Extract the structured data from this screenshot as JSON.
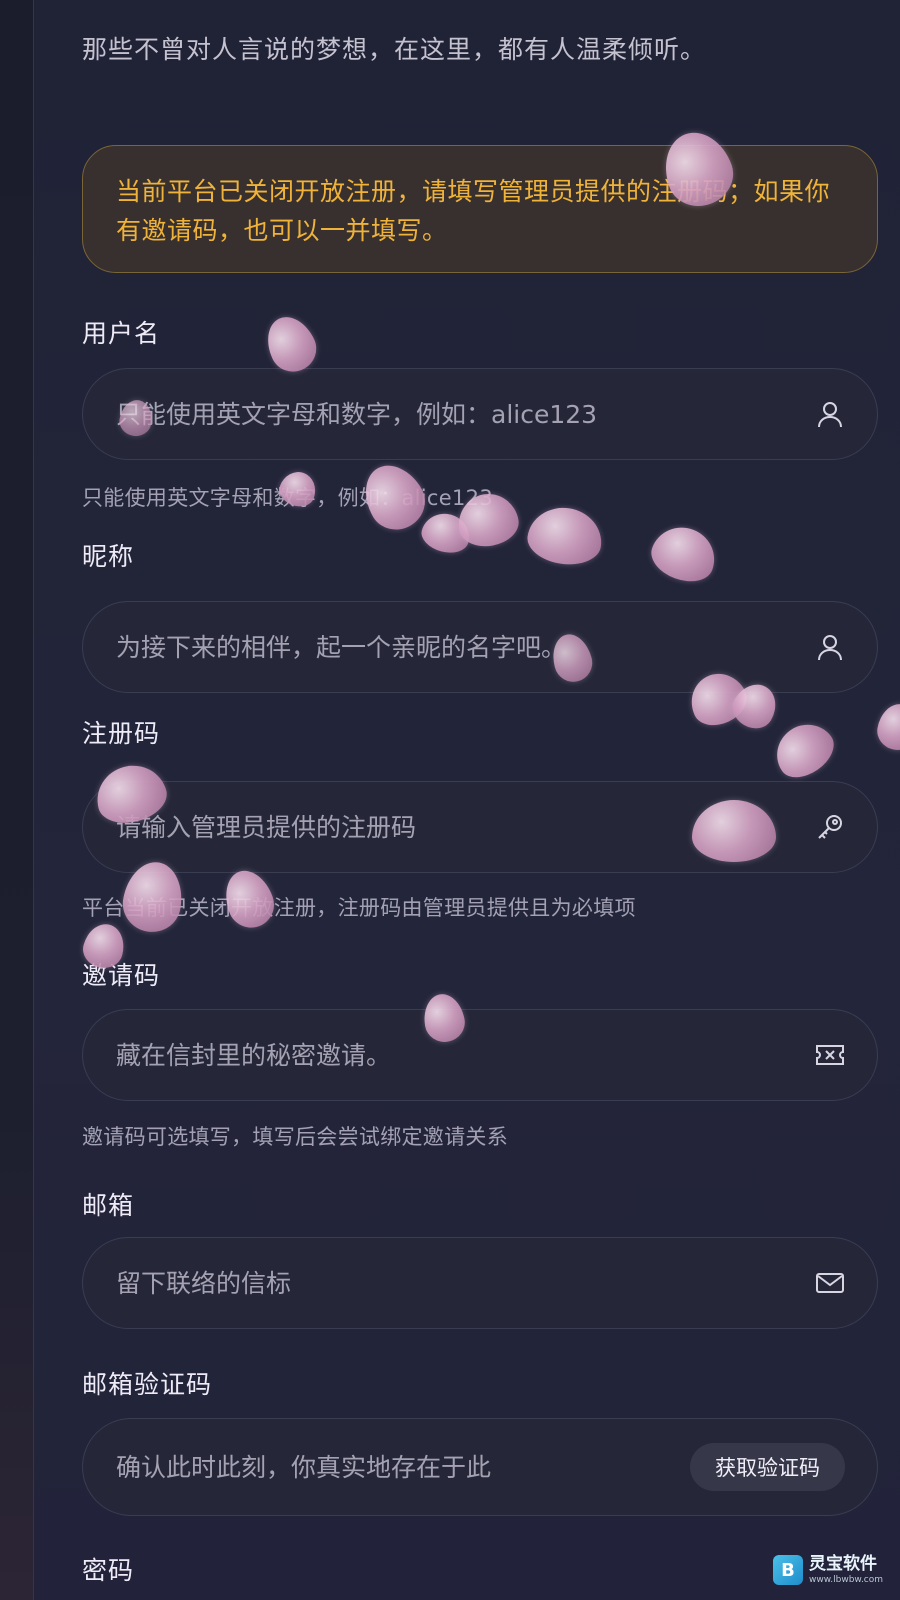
{
  "intro": "那些不曾对人言说的梦想，在这里，都有人温柔倾听。",
  "notice": "当前平台已关闭开放注册，请填写管理员提供的注册码；如果你有邀请码，也可以一并填写。",
  "fields": {
    "username": {
      "label": "用户名",
      "placeholder": "只能使用英文字母和数字，例如：alice123",
      "hint": "只能使用英文字母和数字，例如：alice123",
      "icon": "user-icon"
    },
    "nickname": {
      "label": "昵称",
      "placeholder": "为接下来的相伴，起一个亲昵的名字吧。",
      "icon": "user-icon"
    },
    "register_code": {
      "label": "注册码",
      "placeholder": "请输入管理员提供的注册码",
      "hint": "平台当前已关闭开放注册，注册码由管理员提供且为必填项",
      "icon": "key-icon"
    },
    "invite_code": {
      "label": "邀请码",
      "placeholder": "藏在信封里的秘密邀请。",
      "hint": "邀请码可选填写，填写后会尝试绑定邀请关系",
      "icon": "ticket-icon"
    },
    "email": {
      "label": "邮箱",
      "placeholder": "留下联络的信标",
      "icon": "mail-icon"
    },
    "email_code": {
      "label": "邮箱验证码",
      "placeholder": "确认此时此刻，你真实地存在于此",
      "button": "获取验证码"
    },
    "password": {
      "label": "密码"
    }
  },
  "watermark": {
    "name": "灵宝软件",
    "url": "www.lbwbw.com"
  },
  "colors": {
    "background": "#1f2133",
    "notice_text": "#f0b33a",
    "notice_border": "#7a6536",
    "field_border": "#3a3c52",
    "petal": "#d6a3c5"
  }
}
